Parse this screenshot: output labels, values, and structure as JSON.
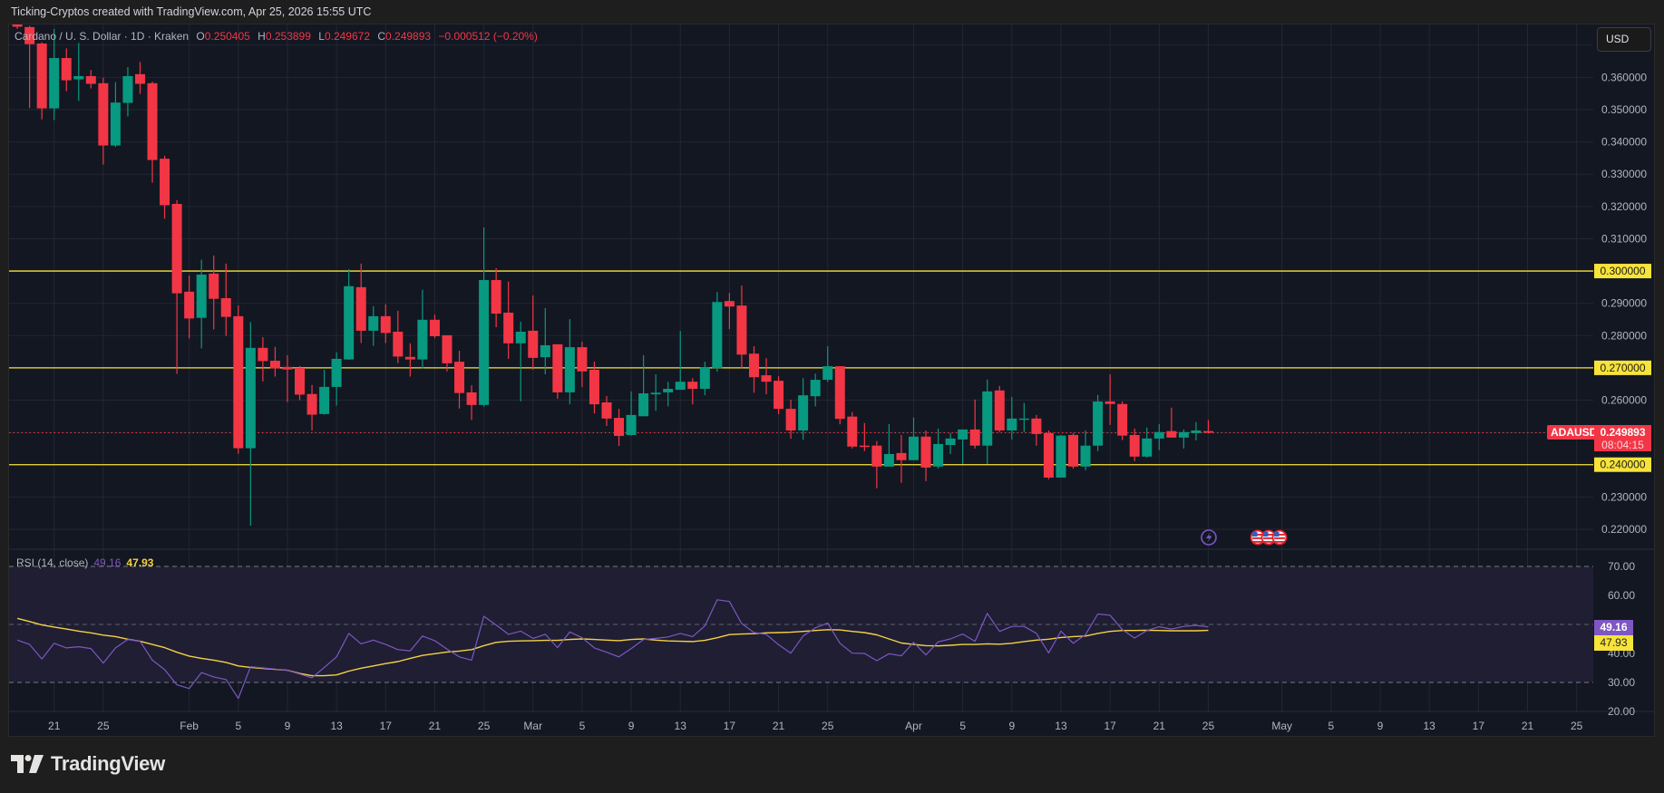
{
  "header": {
    "attribution": "Ticking-Cryptos created with TradingView.com, Apr 25, 2026 15:55 UTC"
  },
  "legend": {
    "symbol": "Cardano / U. S. Dollar · 1D · Kraken",
    "o_label": "O",
    "o": "0.250405",
    "h_label": "H",
    "h": "0.253899",
    "l_label": "L",
    "l": "0.249672",
    "c_label": "C",
    "c": "0.249893",
    "change": "−0.000512 (−0.20%)"
  },
  "currency_button": "USD",
  "price_axis": {
    "ticks": [
      "0.360000",
      "0.350000",
      "0.340000",
      "0.330000",
      "0.320000",
      "0.310000",
      "0.290000",
      "0.280000",
      "0.260000",
      "0.230000",
      "0.220000"
    ],
    "tick_values": [
      0.36,
      0.35,
      0.34,
      0.33,
      0.32,
      0.31,
      0.29,
      0.28,
      0.26,
      0.23,
      0.22
    ]
  },
  "horizontal_lines": [
    {
      "value": 0.3,
      "label": "0.300000"
    },
    {
      "value": 0.27,
      "label": "0.270000"
    },
    {
      "value": 0.24,
      "label": "0.240000"
    }
  ],
  "last_price": {
    "symbol": "ADAUSD",
    "price": "0.249893",
    "value": 0.249893,
    "countdown": "08:04:15"
  },
  "rsi": {
    "legend": "RSI (14, close)",
    "value": "49.16",
    "ma_value": "47.93",
    "rsi_num": 49.16,
    "ma_num": 47.93,
    "ticks": [
      "70.00",
      "60.00",
      "40.00",
      "30.00",
      "20.00"
    ],
    "tick_values": [
      70,
      60,
      40,
      30,
      20
    ],
    "band": [
      30,
      70
    ],
    "mid": 50
  },
  "time_axis": {
    "labels": [
      {
        "text": "21",
        "day": 0
      },
      {
        "text": "25",
        "day": 4
      },
      {
        "text": "Feb",
        "day": 11
      },
      {
        "text": "5",
        "day": 15
      },
      {
        "text": "9",
        "day": 19
      },
      {
        "text": "13",
        "day": 23
      },
      {
        "text": "17",
        "day": 27
      },
      {
        "text": "21",
        "day": 31
      },
      {
        "text": "25",
        "day": 35
      },
      {
        "text": "Mar",
        "day": 39
      },
      {
        "text": "5",
        "day": 43
      },
      {
        "text": "9",
        "day": 47
      },
      {
        "text": "13",
        "day": 51
      },
      {
        "text": "17",
        "day": 55
      },
      {
        "text": "21",
        "day": 59
      },
      {
        "text": "25",
        "day": 63
      },
      {
        "text": "Apr",
        "day": 70
      },
      {
        "text": "5",
        "day": 74
      },
      {
        "text": "9",
        "day": 78
      },
      {
        "text": "13",
        "day": 82
      },
      {
        "text": "17",
        "day": 86
      },
      {
        "text": "21",
        "day": 90
      },
      {
        "text": "25",
        "day": 94
      },
      {
        "text": "May",
        "day": 100
      },
      {
        "text": "5",
        "day": 104
      },
      {
        "text": "9",
        "day": 108
      },
      {
        "text": "13",
        "day": 112
      },
      {
        "text": "17",
        "day": 116
      },
      {
        "text": "21",
        "day": 120
      },
      {
        "text": "25",
        "day": 124
      }
    ]
  },
  "event_icons": [
    "lightning-icon",
    "us-flag-icon",
    "us-flag-icon",
    "us-flag-icon"
  ],
  "branding": "TradingView",
  "colors": {
    "up": "#089981",
    "down": "#f23645",
    "level_line": "#f7e33a",
    "rsi_line": "#7e57c2",
    "rsi_ma": "#f5d142",
    "background": "#131722",
    "grid": "#232733"
  },
  "chart_data": {
    "type": "candlestick",
    "title": "Cardano / U. S. Dollar · 1D · Kraken",
    "interval": "1D",
    "first_candle_day_offset": -3,
    "x_start": "Jan 18",
    "ylim": [
      0.2154,
      0.3784
    ],
    "candles_ohlc": [
      [
        0.3765,
        0.3775,
        0.375,
        0.3757
      ],
      [
        0.3756,
        0.376,
        0.3505,
        0.3703
      ],
      [
        0.3705,
        0.3709,
        0.347,
        0.3504
      ],
      [
        0.3504,
        0.375,
        0.3468,
        0.366
      ],
      [
        0.366,
        0.369,
        0.3557,
        0.3591
      ],
      [
        0.3594,
        0.3707,
        0.3527,
        0.3604
      ],
      [
        0.3604,
        0.3623,
        0.3566,
        0.358
      ],
      [
        0.3582,
        0.3599,
        0.333,
        0.3389
      ],
      [
        0.3389,
        0.3585,
        0.3385,
        0.3522
      ],
      [
        0.3521,
        0.3632,
        0.3479,
        0.3604
      ],
      [
        0.361,
        0.3648,
        0.3549,
        0.358
      ],
      [
        0.3582,
        0.3587,
        0.3274,
        0.3344
      ],
      [
        0.3348,
        0.3357,
        0.3162,
        0.3204
      ],
      [
        0.3208,
        0.322,
        0.2681,
        0.2931
      ],
      [
        0.2936,
        0.2986,
        0.2791,
        0.2853
      ],
      [
        0.2855,
        0.3035,
        0.276,
        0.2989
      ],
      [
        0.2992,
        0.3048,
        0.2819,
        0.2914
      ],
      [
        0.2916,
        0.3023,
        0.2799,
        0.2858
      ],
      [
        0.286,
        0.2893,
        0.2434,
        0.2451
      ],
      [
        0.2451,
        0.2842,
        0.2211,
        0.2762
      ],
      [
        0.2762,
        0.2795,
        0.2658,
        0.2721
      ],
      [
        0.2722,
        0.2765,
        0.2673,
        0.2698
      ],
      [
        0.2703,
        0.2739,
        0.2594,
        0.2695
      ],
      [
        0.27,
        0.2706,
        0.26,
        0.2617
      ],
      [
        0.2619,
        0.2647,
        0.2506,
        0.2555
      ],
      [
        0.2557,
        0.2694,
        0.2555,
        0.2641
      ],
      [
        0.2641,
        0.2748,
        0.2583,
        0.2728
      ],
      [
        0.2726,
        0.3006,
        0.2725,
        0.2953
      ],
      [
        0.295,
        0.3023,
        0.2777,
        0.2815
      ],
      [
        0.2815,
        0.2891,
        0.2768,
        0.286
      ],
      [
        0.286,
        0.2897,
        0.2777,
        0.2808
      ],
      [
        0.2812,
        0.2877,
        0.2715,
        0.2735
      ],
      [
        0.2734,
        0.2776,
        0.2673,
        0.2726
      ],
      [
        0.2726,
        0.2942,
        0.2698,
        0.2849
      ],
      [
        0.2849,
        0.2865,
        0.2792,
        0.2798
      ],
      [
        0.2801,
        0.2801,
        0.2689,
        0.2714
      ],
      [
        0.2719,
        0.2753,
        0.2574,
        0.2622
      ],
      [
        0.2624,
        0.2646,
        0.2538,
        0.2585
      ],
      [
        0.2585,
        0.3135,
        0.258,
        0.2972
      ],
      [
        0.2972,
        0.3009,
        0.2826,
        0.2868
      ],
      [
        0.2871,
        0.2967,
        0.2728,
        0.2776
      ],
      [
        0.2776,
        0.2843,
        0.2596,
        0.2812
      ],
      [
        0.2815,
        0.2924,
        0.2694,
        0.2731
      ],
      [
        0.2733,
        0.2885,
        0.268,
        0.277
      ],
      [
        0.2773,
        0.2773,
        0.2604,
        0.2624
      ],
      [
        0.2624,
        0.2851,
        0.2587,
        0.2764
      ],
      [
        0.2764,
        0.2781,
        0.2641,
        0.2689
      ],
      [
        0.2694,
        0.2719,
        0.2559,
        0.2587
      ],
      [
        0.2593,
        0.2613,
        0.252,
        0.2543
      ],
      [
        0.2545,
        0.2573,
        0.2458,
        0.2489
      ],
      [
        0.2492,
        0.2627,
        0.249,
        0.2554
      ],
      [
        0.255,
        0.2739,
        0.255,
        0.2621
      ],
      [
        0.2618,
        0.268,
        0.2567,
        0.2623
      ],
      [
        0.2624,
        0.2657,
        0.2581,
        0.2635
      ],
      [
        0.2632,
        0.2814,
        0.2632,
        0.2657
      ],
      [
        0.2657,
        0.2668,
        0.2587,
        0.2635
      ],
      [
        0.2635,
        0.2719,
        0.2615,
        0.2702
      ],
      [
        0.2699,
        0.2935,
        0.2688,
        0.2904
      ],
      [
        0.2907,
        0.2932,
        0.282,
        0.289
      ],
      [
        0.2893,
        0.2955,
        0.2699,
        0.2741
      ],
      [
        0.2744,
        0.2767,
        0.2623,
        0.2671
      ],
      [
        0.2677,
        0.273,
        0.2618,
        0.2657
      ],
      [
        0.266,
        0.2674,
        0.2556,
        0.2573
      ],
      [
        0.2573,
        0.2601,
        0.248,
        0.2506
      ],
      [
        0.2506,
        0.2668,
        0.2477,
        0.2615
      ],
      [
        0.2612,
        0.2682,
        0.2581,
        0.2663
      ],
      [
        0.2663,
        0.2767,
        0.2657,
        0.2705
      ],
      [
        0.2705,
        0.2705,
        0.2525,
        0.2542
      ],
      [
        0.2549,
        0.2563,
        0.245,
        0.2456
      ],
      [
        0.2459,
        0.2529,
        0.2442,
        0.2457
      ],
      [
        0.2459,
        0.2473,
        0.2327,
        0.2394
      ],
      [
        0.2394,
        0.2526,
        0.2394,
        0.2433
      ],
      [
        0.2436,
        0.2492,
        0.2344,
        0.2414
      ],
      [
        0.2414,
        0.2546,
        0.2414,
        0.2487
      ],
      [
        0.2487,
        0.2506,
        0.2349,
        0.2391
      ],
      [
        0.2394,
        0.2512,
        0.2388,
        0.2464
      ],
      [
        0.2461,
        0.2498,
        0.2433,
        0.2481
      ],
      [
        0.2478,
        0.2509,
        0.2402,
        0.2509
      ],
      [
        0.2509,
        0.2602,
        0.245,
        0.2459
      ],
      [
        0.2459,
        0.2664,
        0.2402,
        0.2627
      ],
      [
        0.263,
        0.2644,
        0.2501,
        0.2506
      ],
      [
        0.2506,
        0.261,
        0.2478,
        0.2543
      ],
      [
        0.2541,
        0.2591,
        0.2501,
        0.2543
      ],
      [
        0.2543,
        0.2554,
        0.2459,
        0.2495
      ],
      [
        0.2498,
        0.2506,
        0.2355,
        0.236
      ],
      [
        0.236,
        0.2492,
        0.236,
        0.249
      ],
      [
        0.2492,
        0.2498,
        0.2388,
        0.2394
      ],
      [
        0.2394,
        0.2506,
        0.2383,
        0.2459
      ],
      [
        0.2459,
        0.2616,
        0.2442,
        0.2596
      ],
      [
        0.2596,
        0.268,
        0.2523,
        0.2588
      ],
      [
        0.2588,
        0.2596,
        0.2476,
        0.249
      ],
      [
        0.2492,
        0.2512,
        0.2411,
        0.2425
      ],
      [
        0.2425,
        0.2515,
        0.2422,
        0.2481
      ],
      [
        0.2481,
        0.2526,
        0.2445,
        0.2501
      ],
      [
        0.2504,
        0.2577,
        0.2484,
        0.2484
      ],
      [
        0.2484,
        0.2509,
        0.245,
        0.2501
      ],
      [
        0.2498,
        0.2532,
        0.2475,
        0.2506
      ],
      [
        0.250405,
        0.253899,
        0.249672,
        0.249893
      ]
    ],
    "rsi_series": {
      "name": "RSI (14, close)",
      "values": [
        44.6,
        43.1,
        38.1,
        43.5,
        41.9,
        42.3,
        41.7,
        36.7,
        41.9,
        44.8,
        44.2,
        37.7,
        34.4,
        29.2,
        27.9,
        33.4,
        31.9,
        31.0,
        24.5,
        35.4,
        35.0,
        34.6,
        34.2,
        32.9,
        31.6,
        35.2,
        38.8,
        46.9,
        43.3,
        44.6,
        43.1,
        41.3,
        40.9,
        46.0,
        44.4,
        41.5,
        38.8,
        37.7,
        52.8,
        49.8,
        46.6,
        47.7,
        45.2,
        46.6,
        42.0,
        47.4,
        45.4,
        41.9,
        40.4,
        38.8,
        41.7,
        44.8,
        45.2,
        45.7,
        46.9,
        45.8,
        49.5,
        58.5,
        57.9,
        50.3,
        47.2,
        46.6,
        43.0,
        40.1,
        46.0,
        48.8,
        50.5,
        43.5,
        40.1,
        40.0,
        37.5,
        39.9,
        39.2,
        43.8,
        39.5,
        44.0,
        45.0,
        46.7,
        44.2,
        53.8,
        47.6,
        49.3,
        49.3,
        46.9,
        40.2,
        47.7,
        43.5,
        46.5,
        53.6,
        53.2,
        48.2,
        45.3,
        47.9,
        49.2,
        48.4,
        49.3,
        49.7,
        49.16
      ]
    },
    "rsi_ma_series": {
      "name": "RSI-based MA",
      "values": [
        52.1,
        51.0,
        49.8,
        49.1,
        48.4,
        47.7,
        47.1,
        46.3,
        45.8,
        44.9,
        44.2,
        43.1,
        42.0,
        40.4,
        39.1,
        38.3,
        37.7,
        36.9,
        35.7,
        35.2,
        34.8,
        34.5,
        34.2,
        33.1,
        32.3,
        32.3,
        32.6,
        33.9,
        34.9,
        35.7,
        36.5,
        37.2,
        38.3,
        39.3,
        39.9,
        40.5,
        40.8,
        41.3,
        42.7,
        43.8,
        44.2,
        44.3,
        44.4,
        44.5,
        44.5,
        44.8,
        45.0,
        44.8,
        44.6,
        44.4,
        44.8,
        45.0,
        44.6,
        44.3,
        44.2,
        44.1,
        44.5,
        45.4,
        46.5,
        46.7,
        46.8,
        47.1,
        47.2,
        47.3,
        47.6,
        47.9,
        48.2,
        48.1,
        47.6,
        47.2,
        46.4,
        45.0,
        43.6,
        43.1,
        42.7,
        42.6,
        42.8,
        43.1,
        43.1,
        43.3,
        43.2,
        43.5,
        44.1,
        44.6,
        44.9,
        45.5,
        45.8,
        46.0,
        46.9,
        47.6,
        47.9,
        47.9,
        48.0,
        47.9,
        47.8,
        47.8,
        47.8,
        47.93
      ]
    },
    "rsi_ylim": [
      20,
      70
    ]
  }
}
